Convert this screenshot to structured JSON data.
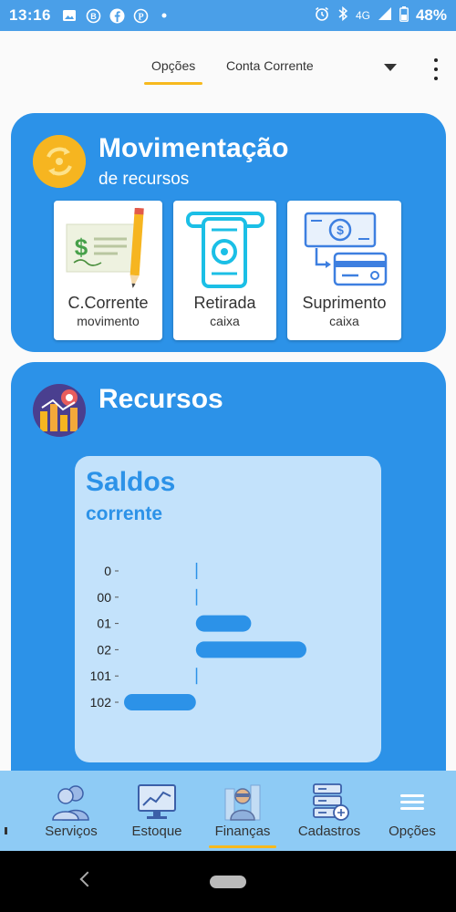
{
  "status_bar": {
    "time": "13:16",
    "left_icons": [
      "image-icon",
      "b-badge-icon",
      "facebook-icon",
      "pinterest-icon",
      "dot-icon"
    ],
    "network": "4G",
    "battery": "48%"
  },
  "top_tabs": {
    "tabs": [
      {
        "label": "Opções",
        "active": true
      },
      {
        "label": "Conta Corrente",
        "active": false
      }
    ]
  },
  "movimentacao": {
    "title": "Movimentação",
    "subtitle": "de recursos",
    "tiles": [
      {
        "label": "C.Corrente",
        "sub": "movimento",
        "icon": "check-pencil-icon"
      },
      {
        "label": "Retirada",
        "sub": "caixa",
        "icon": "atm-withdraw-icon"
      },
      {
        "label": "Suprimento",
        "sub": "caixa",
        "icon": "cash-to-card-icon"
      }
    ]
  },
  "recursos": {
    "title": "Recursos",
    "panel_title": "Saldos",
    "panel_subtitle": "corrente"
  },
  "chart_data": {
    "type": "bar",
    "orientation": "horizontal",
    "categories": [
      "0",
      "00",
      "01",
      "02",
      "101",
      "102"
    ],
    "values": [
      0,
      0,
      1,
      2,
      0,
      -1.3
    ],
    "xlim": [
      -1.3,
      2
    ],
    "title": "Saldos",
    "subtitle": "corrente",
    "xlabel": "",
    "ylabel": "",
    "grid": false,
    "colors": {
      "bar": "#2c92e8"
    }
  },
  "bottom_nav": {
    "items": [
      {
        "label": "Serviços",
        "icon": "people-icon",
        "active": false
      },
      {
        "label": "Estoque",
        "icon": "chart-monitor-icon",
        "active": false
      },
      {
        "label": "Finanças",
        "icon": "finance-person-icon",
        "active": true
      },
      {
        "label": "Cadastros",
        "icon": "server-list-icon",
        "active": false
      },
      {
        "label": "Opções",
        "icon": "menu-icon",
        "active": false
      }
    ]
  },
  "colors": {
    "primary": "#2c92e8",
    "status_bar": "#4a9fe8",
    "accent": "#f7b91d",
    "bottom_nav": "#8ecbf5",
    "panel": "#c3e2fb"
  }
}
